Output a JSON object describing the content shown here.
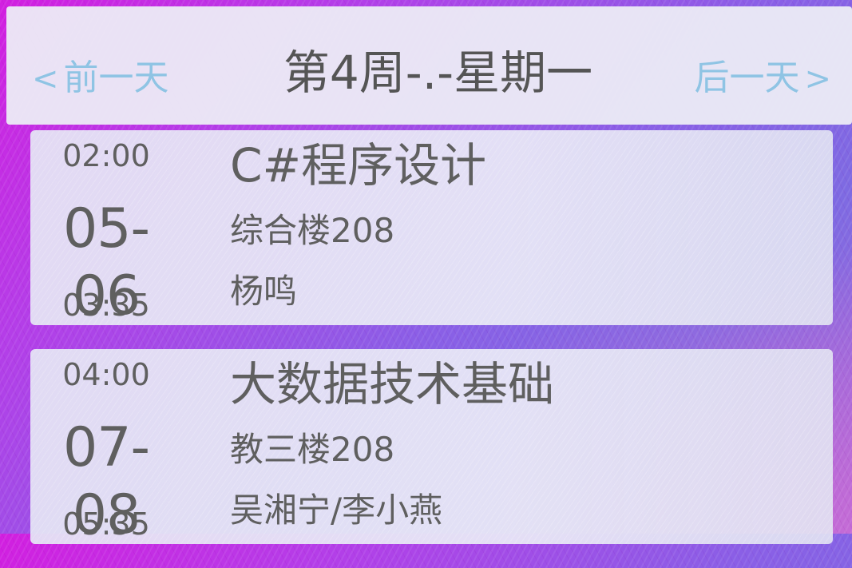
{
  "header": {
    "prev_label": "前一天",
    "next_label": "后一天",
    "title": "第4周-.-星期一"
  },
  "courses": [
    {
      "start_time": "02:00",
      "section_range": "05-06",
      "end_time": "03:35",
      "name": "C#程序设计",
      "room": "综合楼208",
      "teacher": "杨鸣"
    },
    {
      "start_time": "04:00",
      "section_range": "07-08",
      "end_time": "05:35",
      "name": "大数据技术基础",
      "room": "教三楼208",
      "teacher": "吴湘宁/李小燕"
    }
  ],
  "colors": {
    "nav_link": "#8fc4e4",
    "text": "#5f5f5f",
    "title_text": "#555555",
    "panel": "#ececf6"
  },
  "icons": {
    "prev": "chevron-left-icon",
    "next": "chevron-right-icon"
  }
}
